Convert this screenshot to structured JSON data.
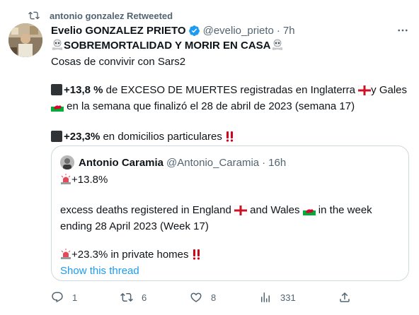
{
  "retweet": {
    "label": "antonio gonzalez Retweeted",
    "icon": "retweet-icon"
  },
  "tweet": {
    "author_name": "Evelio GONZALEZ PRIETO",
    "verified": true,
    "handle": "@evelio_prieto",
    "separator": "·",
    "time": "7h",
    "title": "SOBREMORTALIDAD Y MORIR EN CASA",
    "subtitle": "Cosas de convivir con Sars2",
    "line1_value": "+13,8 %",
    "line1_text": " de EXCESO DE MUERTES registradas en Inglaterra ",
    "line1_after": "y Gales",
    "line2_text": " en la semana que finalizó el 28 de abril de 2023 (semana 17)",
    "line3_value": "+23,3%",
    "line3_text": " en domicilios particulares "
  },
  "quote": {
    "author_name": "Antonio Caramia",
    "handle": "@Antonio_Caramia",
    "separator": "·",
    "time": "16h",
    "line1": "+13.8%",
    "line2_a": "excess deaths registered in England ",
    "line2_b": " and Wales ",
    "line2_c": " in the week",
    "line3": "ending 28 April 2023 (Week 17)",
    "line4": "+23.3% in private homes ",
    "show_thread": "Show this thread"
  },
  "actions": {
    "reply_count": "1",
    "retweet_count": "6",
    "like_count": "8",
    "views_count": "331"
  },
  "colors": {
    "accent": "#1d9bf0",
    "muted": "#536471",
    "text": "#0f1419",
    "border": "#cfd9de"
  }
}
